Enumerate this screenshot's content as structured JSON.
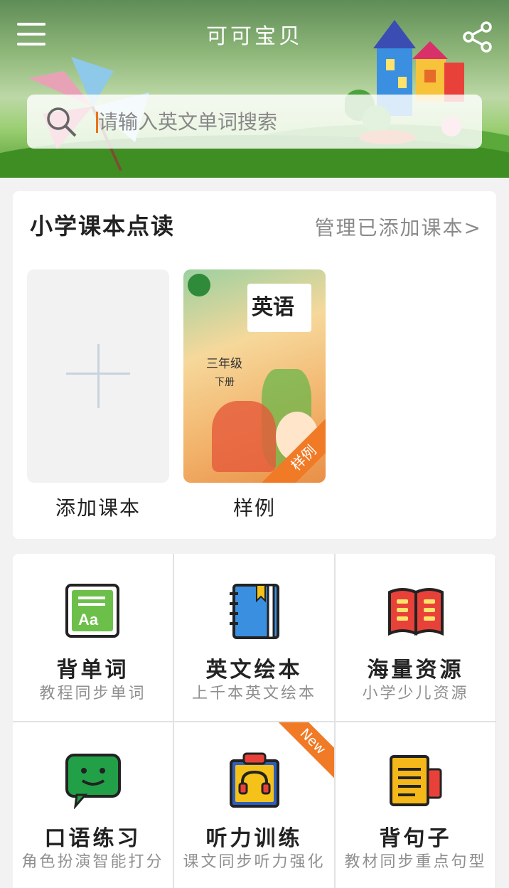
{
  "header": {
    "title": "可可宝贝",
    "menu_icon": "menu-icon",
    "share_icon": "share-icon"
  },
  "search": {
    "placeholder": "请输入英文单词搜索",
    "icon": "search-icon"
  },
  "textbook_section": {
    "title": "小学课本点读",
    "manage_link": "管理已添加课本>",
    "books": [
      {
        "label": "添加课本",
        "icon": "plus-icon"
      },
      {
        "label": "样例",
        "cover": {
          "title": "英语",
          "grade": "三年级",
          "term": "下册",
          "ribbon": "样例"
        }
      }
    ]
  },
  "features": [
    {
      "title": "背单词",
      "subtitle": "教程同步单词",
      "icon": "vocabulary-card-icon",
      "color": "#6cc04a"
    },
    {
      "title": "英文绘本",
      "subtitle": "上千本英文绘本",
      "icon": "notebook-icon",
      "color": "#3a8fe0"
    },
    {
      "title": "海量资源",
      "subtitle": "小学少儿资源",
      "icon": "open-book-icon",
      "color": "#e8413a"
    },
    {
      "title": "口语练习",
      "subtitle": "角色扮演智能打分",
      "icon": "chat-bubble-icon",
      "color": "#22a047"
    },
    {
      "title": "听力训练",
      "subtitle": "课文同步听力强化",
      "icon": "headphones-clipboard-icon",
      "color": "#f5c21a",
      "badge": "New"
    },
    {
      "title": "背句子",
      "subtitle": "教材同步重点句型",
      "icon": "scroll-icon",
      "color": "#f5b81a"
    }
  ],
  "colors": {
    "accent": "#f07a25",
    "card_bg": "#ffffff",
    "page_bg": "#f2f2f2"
  }
}
